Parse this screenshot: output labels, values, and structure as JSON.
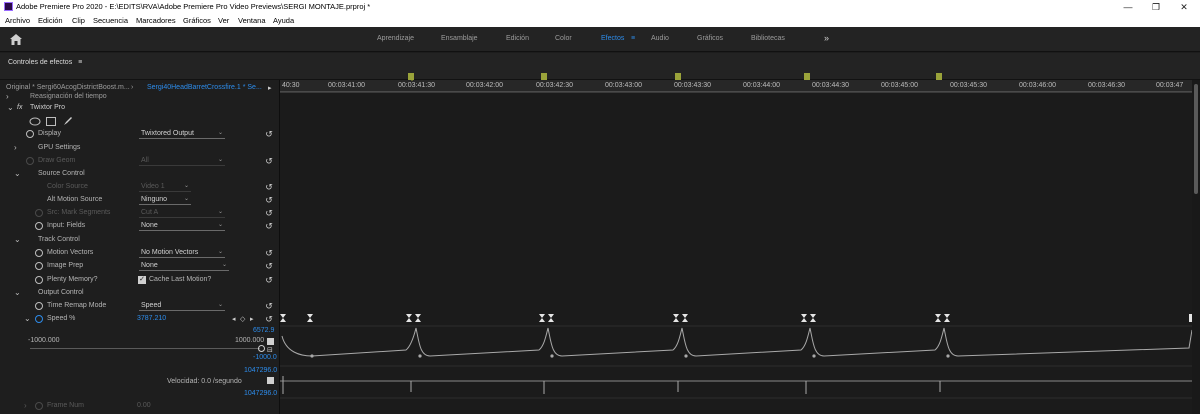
{
  "window": {
    "title": "Adobe Premiere Pro 2020 - E:\\EDITS\\RVA\\Adobe Premiere Pro Video Previews\\SERGI MONTAJE.prproj *",
    "minimize": "—",
    "maximize": "❐",
    "close": "✕"
  },
  "menu": [
    "Archivo",
    "Edición",
    "Clip",
    "Secuencia",
    "Marcadores",
    "Gráficos",
    "Ver",
    "Ventana",
    "Ayuda"
  ],
  "workspaces": [
    "Aprendizaje",
    "Ensamblaje",
    "Edición",
    "Color",
    "Efectos",
    "Audio",
    "Gráficos",
    "Bibliotecas"
  ],
  "workspace_active": "Efectos",
  "workspace_menu_icon": "≡",
  "workspace_overflow": "»",
  "panel": {
    "title": "Controles de efectos",
    "menu_icon": "≡",
    "source_label": "Original * Sergi60AcogDistrictBoost.m...",
    "sequence_label": "Sergi40HeadBarretCrossfire.1 * Se...",
    "sub_label": "Reasignación del tiempo",
    "effect_name": "Twixtor Pro"
  },
  "params": {
    "display": {
      "label": "Display",
      "value": "Twixtored Output"
    },
    "gpu": {
      "label": "GPU Settings"
    },
    "draw_geom": {
      "label": "Draw Geom",
      "value": "All"
    },
    "source_control": {
      "label": "Source Control"
    },
    "color_source": {
      "label": "Color Source",
      "value": "Video 1"
    },
    "alt_motion": {
      "label": "Alt Motion Source",
      "value": "Ninguno"
    },
    "src_mark": {
      "label": "Src: Mark Segments",
      "value": "Cut A"
    },
    "input_fields": {
      "label": "Input: Fields",
      "value": "None"
    },
    "track_control": {
      "label": "Track Control"
    },
    "motion_vectors": {
      "label": "Motion Vectors",
      "value": "No Motion Vectors"
    },
    "image_prep": {
      "label": "Image Prep",
      "value": "None"
    },
    "plenty_memory": {
      "label": "Plenty Memory?",
      "checkbox_label": "Cache Last Motion?"
    },
    "output_control": {
      "label": "Output Control"
    },
    "time_remap": {
      "label": "Time Remap Mode",
      "value": "Speed"
    },
    "speed": {
      "label": "Speed %",
      "value": "3787.210"
    },
    "frame_num": {
      "label": "Frame Num",
      "value": "0.00"
    }
  },
  "graph": {
    "max_top": "6572.9",
    "min_left": "-1000.000",
    "max_right": "1000.000",
    "min_bottom": "-1000.0",
    "velocity_top": "1047296.0",
    "velocity_label": "Velocidad: 0.0 /segundo",
    "velocity_bottom": "1047296.0"
  },
  "timeline": {
    "ticks": [
      "40:30",
      "00:03:41:00",
      "00:03:41:30",
      "00:03:42:00",
      "00:03:42:30",
      "00:03:43:00",
      "00:03:43:30",
      "00:03:44:00",
      "00:03:44:30",
      "00:03:45:00",
      "00:03:45:30",
      "00:03:46:00",
      "00:03:46:30",
      "00:03:47"
    ]
  },
  "colors": {
    "accent": "#2d8ceb",
    "marker": "#9aa33a"
  }
}
